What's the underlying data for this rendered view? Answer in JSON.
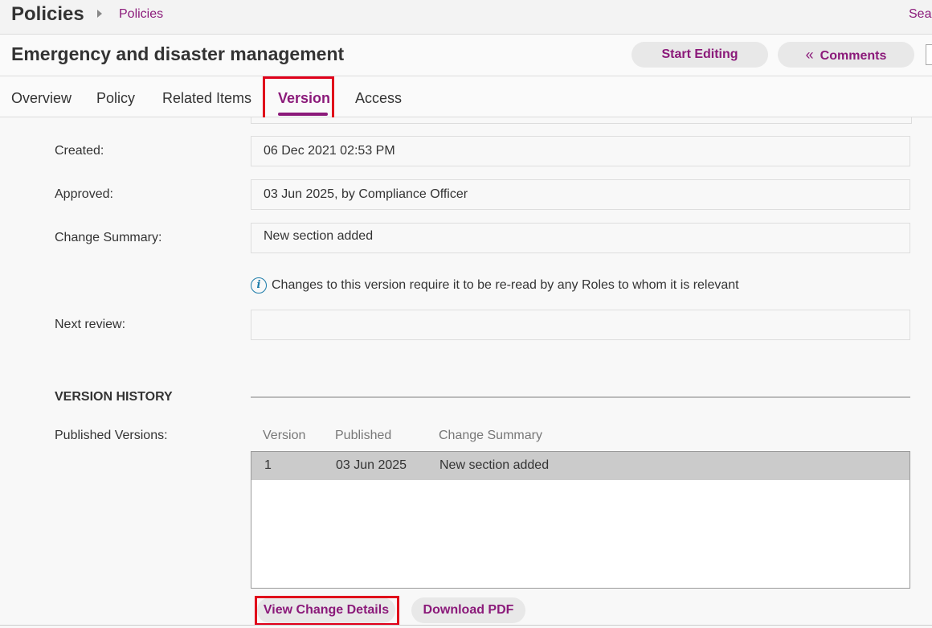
{
  "topbar": {
    "app_title": "Policies",
    "breadcrumb_link": "Policies",
    "search_label": "Sea"
  },
  "header": {
    "page_title": "Emergency and disaster management",
    "start_editing_label": "Start Editing",
    "comments_label": "Comments",
    "comments_icon": "double-chevron-left-icon"
  },
  "tabs": [
    {
      "label": "Overview"
    },
    {
      "label": "Policy"
    },
    {
      "label": "Related Items"
    },
    {
      "label": "Version",
      "active": true
    },
    {
      "label": "Access"
    }
  ],
  "version": {
    "created_label": "Created:",
    "created_value": "06 Dec 2021 02:53 PM",
    "approved_label": "Approved:",
    "approved_value": "03 Jun 2025, by Compliance Officer",
    "change_summary_label": "Change Summary:",
    "change_summary_value": "New section added",
    "info_icon": "info-icon",
    "info_text": "Changes to this version require it to be re-read by any Roles to whom it is relevant",
    "next_review_label": "Next review:",
    "next_review_value": ""
  },
  "history": {
    "section_title": "VERSION HISTORY",
    "published_label": "Published Versions:",
    "columns": [
      "Version",
      "Published",
      "Change Summary"
    ],
    "rows": [
      {
        "version": "1",
        "published": "03 Jun 2025",
        "summary": "New section added"
      }
    ],
    "view_details_label": "View Change Details",
    "download_pdf_label": "Download PDF"
  },
  "colors": {
    "accent": "#8b1a7a",
    "highlight": "#e0001a",
    "info": "#1a7aa8"
  }
}
